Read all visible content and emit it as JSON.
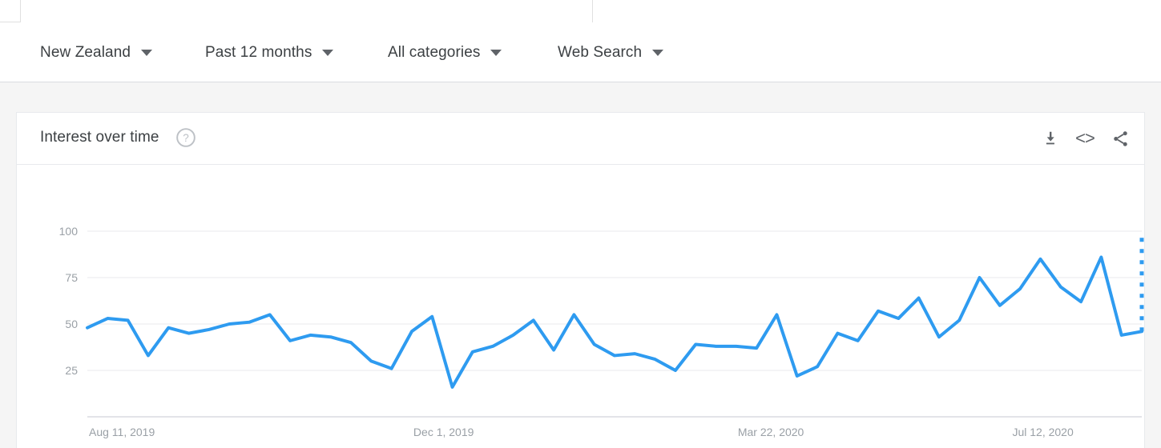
{
  "topbar": {
    "note": ""
  },
  "filters": [
    {
      "label": "New Zealand",
      "name": "region-filter",
      "x": 50
    },
    {
      "label": "Past 12 months",
      "name": "time-filter",
      "x": 256
    },
    {
      "label": "All categories",
      "name": "category-filter",
      "x": 484
    },
    {
      "label": "Web Search",
      "name": "search-type-filter",
      "x": 696
    }
  ],
  "card": {
    "title": "Interest over time",
    "help_icon": "help-circle-icon",
    "actions": [
      {
        "name": "download-csv-button",
        "icon": "download-icon"
      },
      {
        "name": "embed-button",
        "icon": "embed-code-icon",
        "glyph": "<>"
      },
      {
        "name": "share-button",
        "icon": "share-icon"
      }
    ]
  },
  "chart_data": {
    "type": "line",
    "title": "Interest over time",
    "xlabel": "",
    "ylabel": "",
    "ylim": [
      0,
      100
    ],
    "yticks": [
      25,
      50,
      75,
      100
    ],
    "grid": true,
    "legend": false,
    "line_color": "#2e9bf0",
    "xticks": [
      "Aug 11, 2019",
      "Dec 1, 2019",
      "Mar 22, 2020",
      "Jul 12, 2020"
    ],
    "xtick_positions": [
      0,
      16,
      32,
      48
    ],
    "x": [
      "Aug 11, 2019",
      "Aug 18, 2019",
      "Aug 25, 2019",
      "Sep 1, 2019",
      "Sep 8, 2019",
      "Sep 15, 2019",
      "Sep 22, 2019",
      "Sep 29, 2019",
      "Oct 6, 2019",
      "Oct 13, 2019",
      "Oct 20, 2019",
      "Oct 27, 2019",
      "Nov 3, 2019",
      "Nov 10, 2019",
      "Nov 17, 2019",
      "Nov 24, 2019",
      "Dec 1, 2019",
      "Dec 8, 2019",
      "Dec 15, 2019",
      "Dec 22, 2019",
      "Dec 29, 2019",
      "Jan 5, 2020",
      "Jan 12, 2020",
      "Jan 19, 2020",
      "Jan 26, 2020",
      "Feb 2, 2020",
      "Feb 9, 2020",
      "Feb 16, 2020",
      "Feb 23, 2020",
      "Mar 1, 2020",
      "Mar 8, 2020",
      "Mar 15, 2020",
      "Mar 22, 2020",
      "Mar 29, 2020",
      "Apr 5, 2020",
      "Apr 12, 2020",
      "Apr 19, 2020",
      "Apr 26, 2020",
      "May 3, 2020",
      "May 10, 2020",
      "May 17, 2020",
      "May 24, 2020",
      "May 31, 2020",
      "Jun 7, 2020",
      "Jun 14, 2020",
      "Jun 21, 2020",
      "Jun 28, 2020",
      "Jul 5, 2020",
      "Jul 12, 2020",
      "Jul 19, 2020",
      "Jul 26, 2020",
      "Aug 2, 2020",
      "Aug 9, 2020"
    ],
    "values": [
      48,
      53,
      52,
      33,
      48,
      45,
      47,
      50,
      51,
      55,
      41,
      44,
      43,
      40,
      30,
      26,
      46,
      54,
      16,
      35,
      38,
      44,
      52,
      36,
      55,
      39,
      33,
      34,
      31,
      25,
      39,
      38,
      38,
      37,
      55,
      22,
      27,
      45,
      41,
      57,
      53,
      64,
      43,
      52,
      75,
      60,
      69,
      85,
      70,
      62,
      86,
      44,
      46
    ],
    "partial_from_index": 52,
    "partial_values": [
      46,
      100
    ],
    "partial_note": "dotted segment indicates incomplete data"
  }
}
